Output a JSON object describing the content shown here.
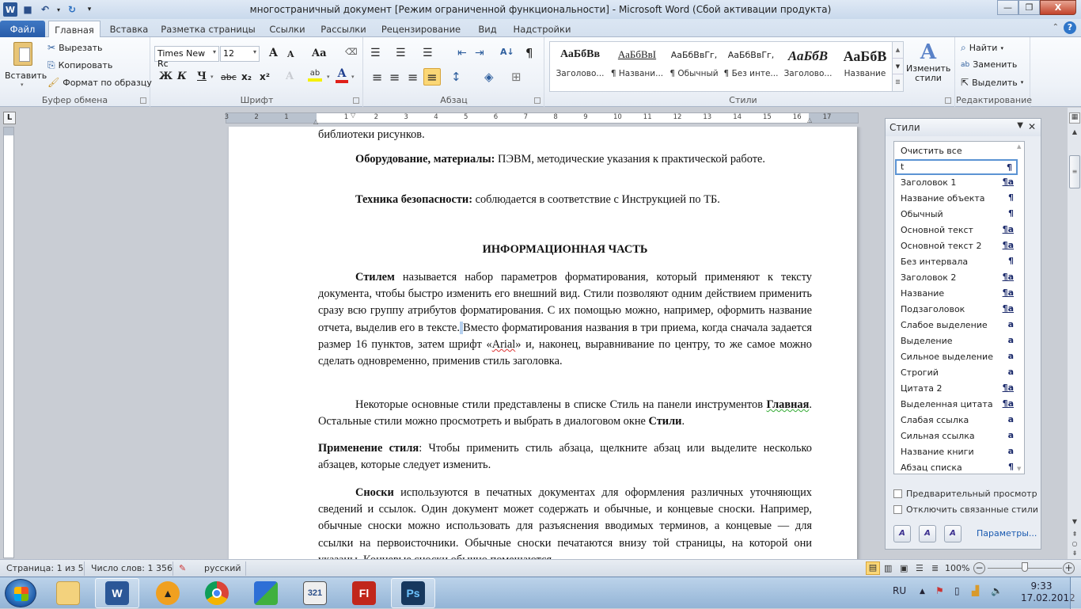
{
  "window": {
    "title": "многостраничный документ [Режим ограниченной функциональности]  -  Microsoft Word (Сбой активации продукта)",
    "minimize": "—",
    "restore": "❐",
    "close": "X"
  },
  "qat": {
    "app_icon": "W",
    "save_icon": "💾",
    "undo_icon": "↶",
    "redo_icon": "↻",
    "customize_icon": "▾"
  },
  "tabs": [
    {
      "label": "Файл"
    },
    {
      "label": "Главная"
    },
    {
      "label": "Вставка"
    },
    {
      "label": "Разметка страницы"
    },
    {
      "label": "Ссылки"
    },
    {
      "label": "Рассылки"
    },
    {
      "label": "Рецензирование"
    },
    {
      "label": "Вид"
    },
    {
      "label": "Надстройки"
    }
  ],
  "ribbon": {
    "clipboard": {
      "group_label": "Буфер обмена",
      "paste": "Вставить",
      "cut": "Вырезать",
      "copy": "Копировать",
      "format_painter": "Формат по образцу"
    },
    "font": {
      "group_label": "Шрифт",
      "font_name": "Times New Rc",
      "font_size": "12",
      "grow": "A",
      "shrink": "A",
      "change_case": "Aa",
      "bold": "Ж",
      "italic": "К",
      "underline": "Ч",
      "strike": "abc",
      "subscript": "x₂",
      "superscript": "x²",
      "effects": "A",
      "highlight": "ab",
      "font_color": "A",
      "highlight_color": "#f5f000",
      "font_color_value": "#e0201a"
    },
    "paragraph": {
      "group_label": "Абзац",
      "bullets": "☰",
      "numbering": "☰",
      "multilevel": "☰",
      "decrease_indent": "⇤",
      "increase_indent": "⇥",
      "sort": "A↓",
      "show_marks": "¶",
      "align_left": "≡",
      "center": "≡",
      "align_right": "≡",
      "justify": "≡",
      "line_spacing": "↕",
      "shading": "◈",
      "borders": "⊞"
    },
    "styles": {
      "group_label": "Стили",
      "gallery": [
        {
          "sample": "АаБбВв",
          "name": "Заголово..."
        },
        {
          "sample": "АаБбВвI",
          "name": "¶ Названи..."
        },
        {
          "sample": "АаБбВвГг,",
          "name": "¶ Обычный"
        },
        {
          "sample": "АаБбВвГг,",
          "name": "¶ Без инте..."
        },
        {
          "sample": "АаБбВ",
          "name": "Заголово..."
        },
        {
          "sample": "АаБбВ",
          "name": "Название"
        }
      ],
      "change_styles": "Изменить стили"
    },
    "editing": {
      "group_label": "Редактирование",
      "find": "Найти",
      "replace": "Заменить",
      "select": "Выделить"
    }
  },
  "ruler": {
    "numbers": [
      "3",
      "2",
      "1",
      "1",
      "2",
      "3",
      "4",
      "5",
      "6",
      "7",
      "8",
      "9",
      "10",
      "11",
      "12",
      "13",
      "14",
      "15",
      "16",
      "17"
    ],
    "tab_selector": "L"
  },
  "document": {
    "p0": "библиотеки рисунков.",
    "p1_bold": "Оборудование,   материалы:",
    "p1_text": " ПЭВМ, методические указания к практической работе.",
    "p2_bold": "Техника безопасности:",
    "p2_text": " соблюдается в соответствие с Инструкцией по ТБ.",
    "heading": "ИНФОРМАЦИОННАЯ  ЧАСТЬ",
    "p3_bold": "Стилем",
    "p3_text_a": " называется набор параметров форматирования, который применяют к тексту документа, чтобы быстро изменить его внешний вид. Стили позволяют одним действием применить сразу всю группу атрибутов форматирования. С их помощью можно, например, оформить название отчета, выделив его в тексте.",
    "p3_selected": " ",
    "p3_text_b": "Вместо форматирования названия в три приема, когда сначала задается размер 16 пунктов, затем шрифт «",
    "p3_arial": "Arial",
    "p3_text_c": "» и, наконец, выравнивание по центру, то же самое можно сделать одновременно, применив стиль заголовка.",
    "p4_text_a": "Некоторые основные стили представлены в списке Стиль на панели инструментов ",
    "p4_bold_a": "Главная",
    "p4_text_b": ". Остальные стили можно просмотреть и выбрать в диалоговом окне ",
    "p4_bold_b": "Стили",
    "p4_text_c": ".",
    "p5_bold": "Применение стиля",
    "p5_text": ": Чтобы применить стиль абзаца, щелкните абзац или выделите несколько абзацев, которые следует изменить.",
    "p6_bold": "Сноски",
    "p6_text": "  используются в печатных документах для оформления различных уточняющих сведений и ссылок. Один документ может содержать и обычные, и концевые сноски. Например, обычные сноски можно использовать для разъяснения вводимых терминов, а концевые — для ссылки на первоисточники. Обычные сноски печатаются внизу той страницы, на которой они указаны. Концевые сноски обычно помещаются"
  },
  "styles_pane": {
    "title": "Стили",
    "items": [
      {
        "name": "Очистить все",
        "mark": ""
      },
      {
        "name": "t",
        "mark": "¶"
      },
      {
        "name": "Заголовок 1",
        "mark": "¶a"
      },
      {
        "name": "Название объекта",
        "mark": "¶"
      },
      {
        "name": "Обычный",
        "mark": "¶"
      },
      {
        "name": "Основной текст",
        "mark": "¶a"
      },
      {
        "name": "Основной текст 2",
        "mark": "¶a"
      },
      {
        "name": "Без интервала",
        "mark": "¶"
      },
      {
        "name": "Заголовок 2",
        "mark": "¶a"
      },
      {
        "name": "Название",
        "mark": "¶a"
      },
      {
        "name": "Подзаголовок",
        "mark": "¶a"
      },
      {
        "name": "Слабое выделение",
        "mark": "a"
      },
      {
        "name": "Выделение",
        "mark": "a"
      },
      {
        "name": "Сильное выделение",
        "mark": "a"
      },
      {
        "name": "Строгий",
        "mark": "a"
      },
      {
        "name": "Цитата 2",
        "mark": "¶a"
      },
      {
        "name": "Выделенная цитата",
        "mark": "¶a"
      },
      {
        "name": "Слабая ссылка",
        "mark": "a"
      },
      {
        "name": "Сильная ссылка",
        "mark": "a"
      },
      {
        "name": "Название книги",
        "mark": "a"
      },
      {
        "name": "Абзац списка",
        "mark": "¶"
      }
    ],
    "current_index": 1,
    "preview_label": "Предварительный просмотр",
    "preview_checked": false,
    "disable_linked_label": "Отключить связанные стили",
    "disable_linked_checked": false,
    "options_link": "Параметры..."
  },
  "statusbar": {
    "page": "Страница: 1 из 5",
    "words": "Число слов: 1 356",
    "language": "русский",
    "zoom": "100%",
    "zoom_percent": 100
  },
  "taskbar": {
    "apps": [
      {
        "name": "explorer",
        "label": ""
      },
      {
        "name": "word",
        "label": "W"
      },
      {
        "name": "aimp",
        "label": "▲"
      },
      {
        "name": "chrome",
        "label": ""
      },
      {
        "name": "app-boxes",
        "label": ""
      },
      {
        "name": "media-player-classic",
        "label": "321"
      },
      {
        "name": "flash",
        "label": "Fl"
      },
      {
        "name": "photoshop",
        "label": "Ps"
      }
    ],
    "lang": "RU",
    "time": "9:33",
    "date": "17.02.2012"
  }
}
